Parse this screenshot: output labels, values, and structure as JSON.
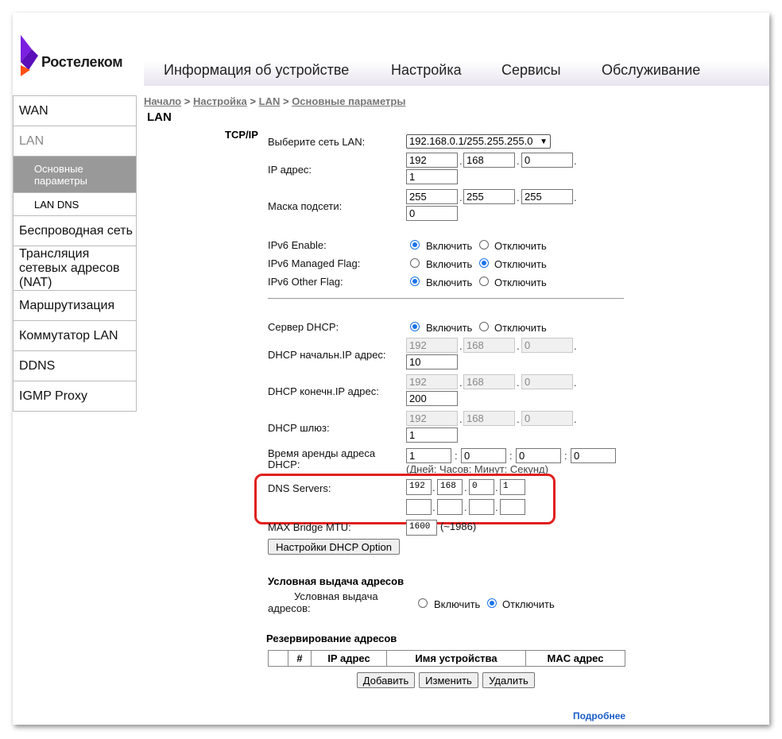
{
  "brand": {
    "name": "Ростелеком",
    "colors": {
      "purple": "#7b1fe0",
      "orange": "#ff4f12"
    }
  },
  "topnav": [
    "Информация об устройстве",
    "Настройка",
    "Сервисы",
    "Обслуживание"
  ],
  "breadcrumb": {
    "items": [
      "Начало",
      "Настройка",
      "LAN",
      "Основные параметры"
    ],
    "sep": ">"
  },
  "page_title": "LAN",
  "sidebar": {
    "wan": "WAN",
    "lan": "LAN",
    "lan_basic": "Основные параметры",
    "lan_dns": "LAN DNS",
    "wireless": "Беспроводная сеть",
    "nat": "Трансляция сетевых адресов (NAT)",
    "routing": "Маршрутизация",
    "switch": "Коммутатор LAN",
    "ddns": "DDNS",
    "igmp": "IGMP Proxy"
  },
  "tcpip": {
    "section": "TCP/IP",
    "lan_select_label": "Выберите сеть LAN:",
    "lan_select_value": "192.168.0.1/255.255.255.0",
    "ip_label": "IP адрес:",
    "ip": [
      "192",
      "168",
      "0",
      "1"
    ],
    "mask_label": "Маска подсети:",
    "mask": [
      "255",
      "255",
      "255",
      "0"
    ],
    "ipv6_enable_label": "IPv6 Enable:",
    "ipv6_managed_label": "IPv6 Managed Flag:",
    "ipv6_other_label": "IPv6 Other Flag:",
    "on": "Включить",
    "off": "Отключить",
    "ipv6_enable": "on",
    "ipv6_managed": "off",
    "ipv6_other": "on"
  },
  "dhcp": {
    "server_label": "Сервер DHCP:",
    "server": "on",
    "start_label": "DHCP начальн.IP адрес:",
    "start": [
      "192",
      "168",
      "0",
      "10"
    ],
    "end_label": "DHCP конечн.IP адрес:",
    "end": [
      "192",
      "168",
      "0",
      "200"
    ],
    "gw_label": "DHCP шлюз:",
    "gw": [
      "192",
      "168",
      "0",
      "1"
    ],
    "lease_label": "Время аренды адреса DHCP:",
    "lease": [
      "1",
      "0",
      "0",
      "0"
    ],
    "lease_hint": "(Дней: Часов: Минут: Секунд)",
    "dns_label": "DNS Servers:",
    "dns1": [
      "192",
      "168",
      "0",
      "1"
    ],
    "dns2": [
      "",
      "",
      "",
      ""
    ],
    "mtu_label": "MAX Bridge MTU:",
    "mtu": "1600",
    "mtu_hint": "(~1986)",
    "option_button": "Настройки DHCP Option"
  },
  "conditional": {
    "title": "Условная выдача адресов",
    "label": "Условная выдача адресов:",
    "value": "off"
  },
  "reservation": {
    "title": "Резервирование адресов",
    "columns": [
      "",
      "#",
      "IP адрес",
      "Имя устройства",
      "MAC адрес"
    ],
    "add": "Добавить",
    "edit": "Изменить",
    "delete": "Удалить"
  },
  "more_link": "Подробнее"
}
